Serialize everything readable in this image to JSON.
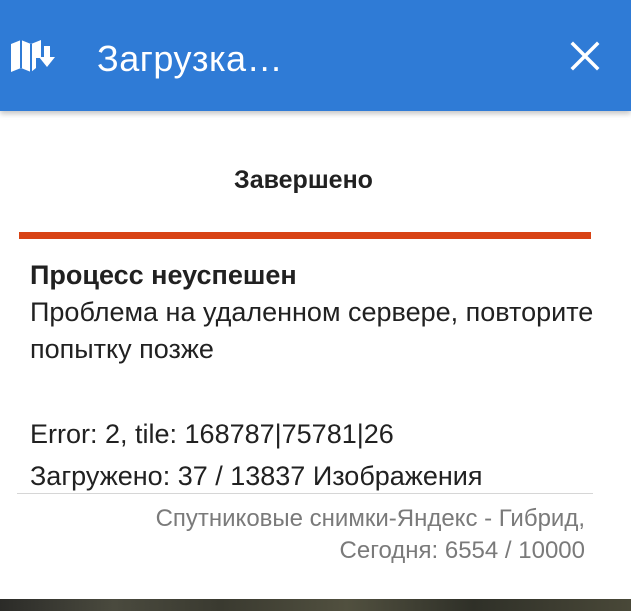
{
  "header": {
    "title": "Загрузка…",
    "map_icon": "map-download-icon",
    "close_icon": "close-icon",
    "background_color": "#2f7bd6"
  },
  "status": {
    "label": "Завершено",
    "progress_fraction": 1.0,
    "progress_color": "#d84315"
  },
  "result": {
    "headline": "Процесс неуспешен",
    "message": "Проблема на удаленном сервере, повторите попытку позже",
    "error": "Error: 2, tile: 168787|75781|26",
    "loaded": "Загружено: 37 / 13837 Изображения"
  },
  "footer": {
    "source": "Спутниковые снимки-Яндекс - Гибрид,",
    "today": "Сегодня: 6554 / 10000"
  }
}
